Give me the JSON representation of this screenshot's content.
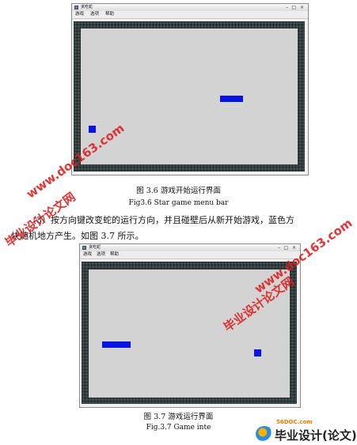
{
  "window1": {
    "title": "贪吃蛇",
    "menu": [
      "游戏",
      "选项",
      "帮助"
    ],
    "controls": [
      "–",
      "□",
      "×"
    ],
    "snake_color": "#0a14e0",
    "board_color": "#3f4a4a",
    "field_color": "#d3d3d3"
  },
  "caption1": {
    "zh": "图 3.6 游戏开始运行界面",
    "en": "Fig3.6    Star game menu bar"
  },
  "paragraph": {
    "line1": "（3）按方向键改变蛇的运行方向，并且碰壁后从新开始游戏，蓝色方",
    "line2": "块随机地方产生。如图 3.7 所示。"
  },
  "window2": {
    "title": "贪吃蛇",
    "menu": [
      "游戏",
      "选项",
      "帮助"
    ],
    "controls": [
      "–",
      "□",
      "×"
    ]
  },
  "caption2": {
    "zh": "图 3.7 游戏运行界面",
    "en": "Fig.3.7    Game inte"
  },
  "watermarks": {
    "url1": "www.doc163.com",
    "site1": "毕业设计论文网",
    "url2": "www.doc163.com",
    "site2": "毕业设计论文网"
  },
  "footer_logo": {
    "url": "56DOC.com",
    "text": "毕业设计(论文)网"
  }
}
